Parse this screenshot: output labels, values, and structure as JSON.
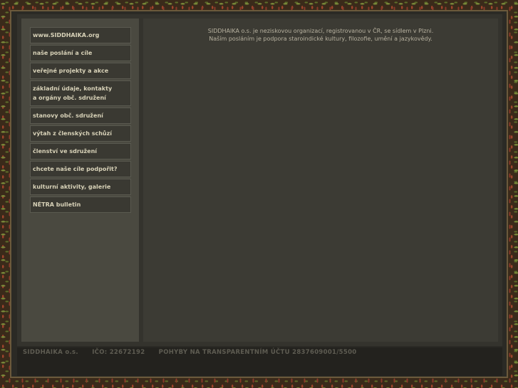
{
  "menu": {
    "items": [
      {
        "lines": [
          "www.SIDDHAIKA.org"
        ]
      },
      {
        "lines": [
          "naše poslání a cíle"
        ]
      },
      {
        "lines": [
          "veřejné projekty a akce"
        ]
      },
      {
        "lines": [
          "základní údaje, kontakty",
          "a orgány obč. sdružení"
        ]
      },
      {
        "lines": [
          "stanovy obč. sdružení"
        ]
      },
      {
        "lines": [
          "výtah z členských schůzí"
        ]
      },
      {
        "lines": [
          "členství ve sdružení"
        ]
      },
      {
        "lines": [
          "chcete naše cíle podpořit?"
        ]
      },
      {
        "lines": [
          "kulturní aktivity, galerie"
        ]
      },
      {
        "lines": [
          "NÉTRA bulletin"
        ]
      }
    ]
  },
  "intro": {
    "line1": "SIDDHAIKA o.s. je neziskovou organizací, registrovanou v ČR, se sídlem v Plzni.",
    "line2": "Naším posláním je podpora staroindické kultury, filozofie, umění a jazykovědy."
  },
  "footer": {
    "org": "SIDDHAIKA o.s.",
    "ico": "IČO: 22672192",
    "account": "POHYBY NA TRANSPARENTNÍM ÚČTU 2837609001/5500"
  }
}
